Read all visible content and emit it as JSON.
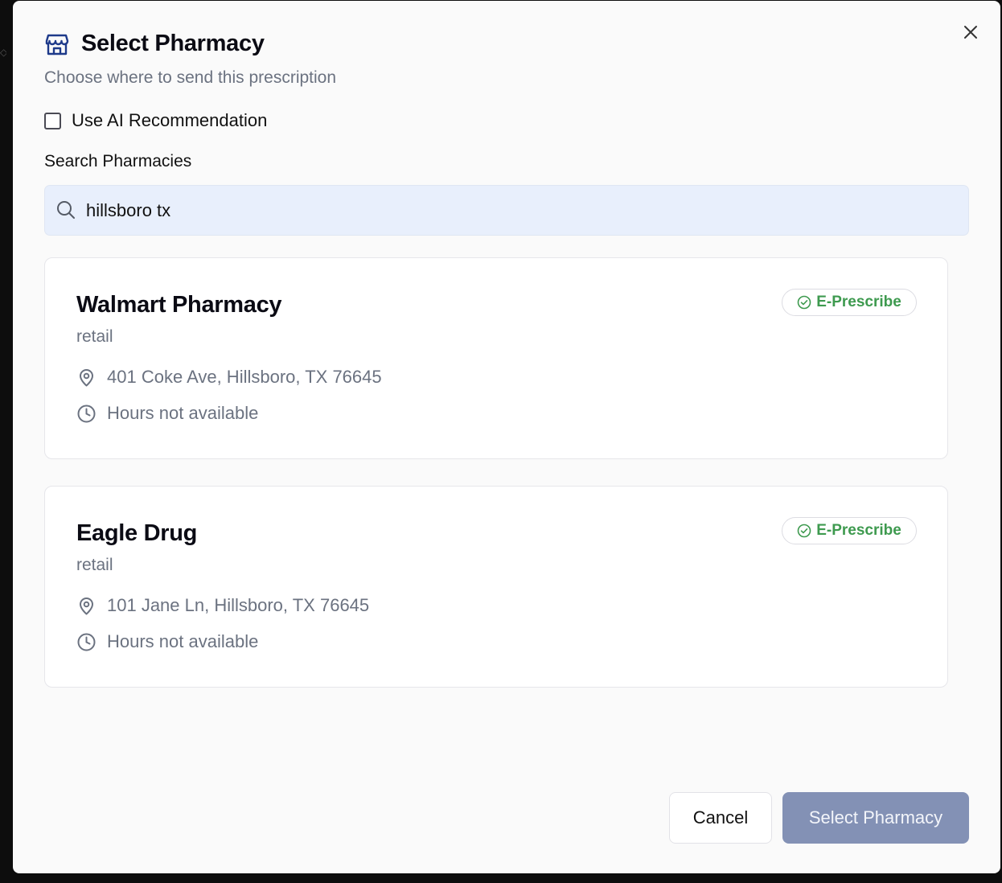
{
  "dialog": {
    "title": "Select Pharmacy",
    "subtitle": "Choose where to send this prescription",
    "title_icon": "store-icon",
    "close_icon": "close-icon"
  },
  "ai_recommendation": {
    "label": "Use AI Recommendation",
    "checked": false
  },
  "search": {
    "label": "Search Pharmacies",
    "value": "hillsboro tx",
    "icon": "search-icon"
  },
  "pharmacies": [
    {
      "name": "Walmart Pharmacy",
      "type": "retail",
      "badge": "E-Prescribe",
      "address": "401 Coke Ave, Hillsboro, TX 76645",
      "hours": "Hours not available"
    },
    {
      "name": "Eagle Drug",
      "type": "retail",
      "badge": "E-Prescribe",
      "address": "101 Jane Ln, Hillsboro, TX 76645",
      "hours": "Hours not available"
    }
  ],
  "actions": {
    "cancel_label": "Cancel",
    "select_label": "Select Pharmacy"
  },
  "colors": {
    "badge_green": "#3e9a4f",
    "primary_disabled": "#8391b5",
    "search_bg": "#e8effc",
    "title_icon_blue": "#1e3a8a"
  }
}
